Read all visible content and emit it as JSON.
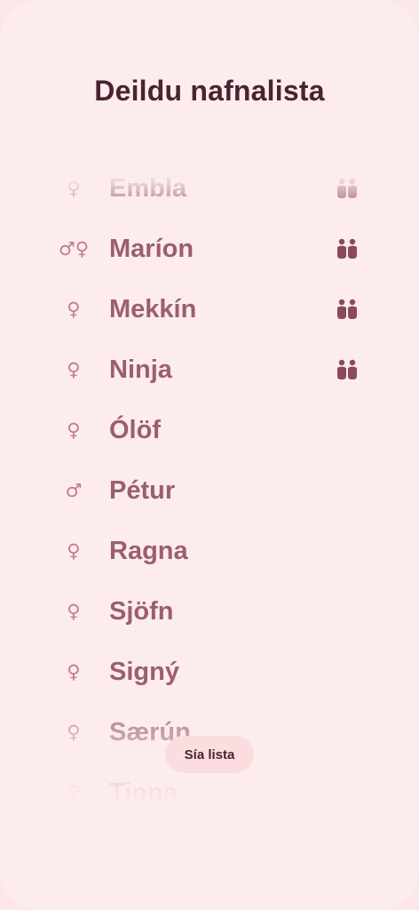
{
  "header": {
    "title": "Deildu nafnalista"
  },
  "names": [
    {
      "gender": "♀",
      "name": "Embla",
      "twins": true
    },
    {
      "gender": "♂♀",
      "name": "Maríon",
      "twins": true
    },
    {
      "gender": "♀",
      "name": "Mekkín",
      "twins": true
    },
    {
      "gender": "♀",
      "name": "Ninja",
      "twins": true
    },
    {
      "gender": "♀",
      "name": "Ólöf",
      "twins": false
    },
    {
      "gender": "♂",
      "name": "Pétur",
      "twins": false
    },
    {
      "gender": "♀",
      "name": "Ragna",
      "twins": false
    },
    {
      "gender": "♀",
      "name": "Sjöfn",
      "twins": false
    },
    {
      "gender": "♀",
      "name": "Signý",
      "twins": false
    },
    {
      "gender": "♀",
      "name": "Særún",
      "twins": false
    },
    {
      "gender": "♀",
      "name": "Tinna",
      "twins": false
    }
  ],
  "filter": {
    "label": "Sía lista"
  },
  "colors": {
    "background": "#fdeced",
    "title": "#4a2330",
    "name": "#9b5e70",
    "gender": "#c17d8e",
    "icon": "#8a4a5c"
  }
}
